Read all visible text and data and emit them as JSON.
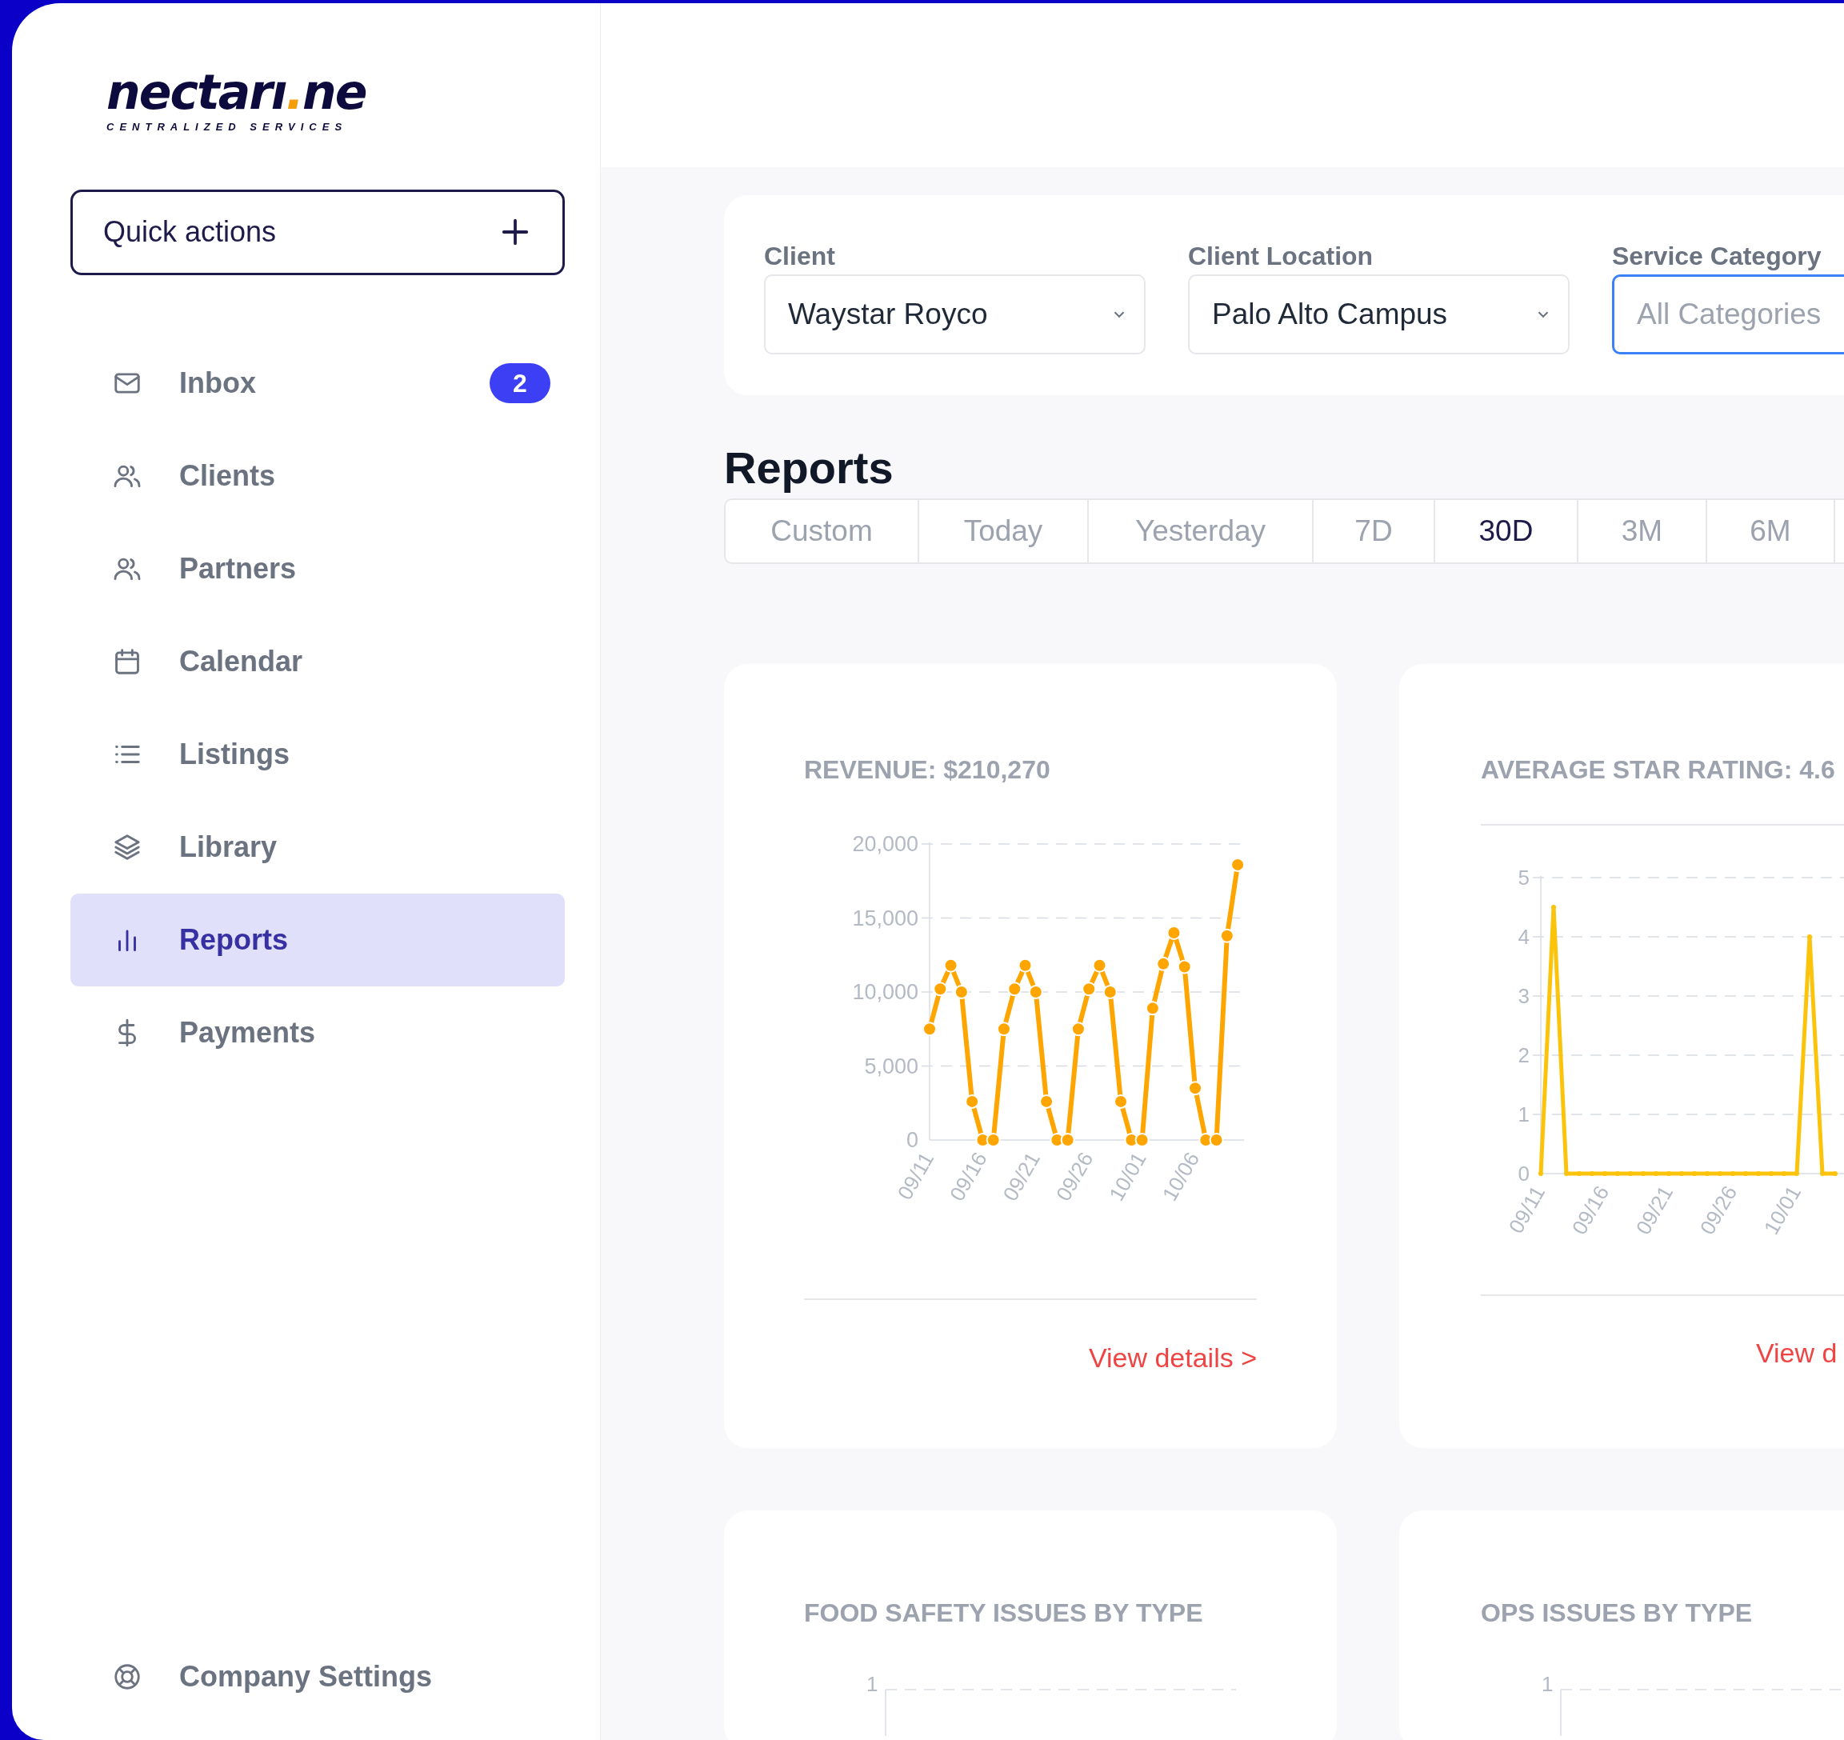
{
  "sidebar": {
    "logo": {
      "wordmark": [
        {
          "text": "nectarı",
          "color": "#0d0b3d"
        },
        {
          "text": ".",
          "color": "#f59e0b"
        },
        {
          "text": "ne",
          "color": "#0d0b3d"
        }
      ],
      "tagline": "CENTRALIZED SERVICES"
    },
    "quick_actions": "Quick actions",
    "nav": [
      {
        "label": "Inbox",
        "selected": false,
        "badge": "2"
      },
      {
        "label": "Clients",
        "selected": false
      },
      {
        "label": "Partners",
        "selected": false
      },
      {
        "label": "Calendar",
        "selected": false
      },
      {
        "label": "Listings",
        "selected": false
      },
      {
        "label": "Library",
        "selected": false
      },
      {
        "label": "Reports",
        "selected": true
      },
      {
        "label": "Payments",
        "selected": false
      }
    ],
    "footer_item": "Company Settings"
  },
  "filters": [
    {
      "label": "Client",
      "value": "Waystar Royco",
      "focused": false
    },
    {
      "label": "Client Location",
      "value": "Palo Alto Campus",
      "focused": false
    },
    {
      "label": "Service Category",
      "placeholder": "All Categories",
      "focused": true
    }
  ],
  "reports": {
    "title": "Reports",
    "ranges": [
      {
        "label": "Custom",
        "selected": false
      },
      {
        "label": "Today",
        "selected": false
      },
      {
        "label": "Yesterday",
        "selected": false
      },
      {
        "label": "7D",
        "selected": false
      },
      {
        "label": "30D",
        "selected": true
      },
      {
        "label": "3M",
        "selected": false
      },
      {
        "label": "6M",
        "selected": false
      }
    ]
  },
  "cards": [
    {
      "kind": "revenue",
      "title": "REVENUE: $210,270",
      "link": "View details >",
      "chart_data": {
        "type": "line",
        "grid": true,
        "categories": [
          "09/11",
          null,
          null,
          null,
          null,
          "09/16",
          null,
          null,
          null,
          null,
          "09/21",
          null,
          null,
          null,
          null,
          "09/26",
          null,
          null,
          null,
          null,
          "10/01",
          null,
          null,
          null,
          null,
          "10/06",
          null,
          null,
          null,
          null
        ],
        "series": [
          {
            "color": "#ffa500",
            "marker": "circle",
            "values": [
              7500,
              10200,
              11800,
              10000,
              2600,
              0,
              0,
              7500,
              10200,
              11800,
              10000,
              2600,
              0,
              0,
              7500,
              10200,
              11800,
              10000,
              2600,
              0,
              0,
              8900,
              11900,
              14000,
              11700,
              3500,
              0,
              0,
              13800,
              18600
            ]
          }
        ],
        "ylim": [
          0,
          20000
        ],
        "yticks": [
          {
            "value": 0,
            "label": "0"
          },
          {
            "value": 5000,
            "label": "5,000"
          },
          {
            "value": 10000,
            "label": "10,000"
          },
          {
            "value": 15000,
            "label": "15,000"
          },
          {
            "value": 20000,
            "label": "20,000"
          }
        ]
      }
    },
    {
      "kind": "rating",
      "title": "AVERAGE STAR RATING: 4.6",
      "link": "View d",
      "chart_data": {
        "type": "line",
        "grid": true,
        "categories": [
          "09/11",
          null,
          null,
          null,
          null,
          "09/16",
          null,
          null,
          null,
          null,
          "09/21",
          null,
          null,
          null,
          null,
          "09/26",
          null,
          null,
          null,
          null,
          "10/01",
          null,
          null,
          null
        ],
        "series": [
          {
            "color": "#fcc30b",
            "marker": "dot",
            "values": [
              0,
              4.5,
              0,
              0,
              0,
              0,
              0,
              0,
              0,
              0,
              0,
              0,
              0,
              0,
              0,
              0,
              0,
              0,
              0,
              0,
              0,
              4,
              0,
              0
            ]
          }
        ],
        "ylim": [
          0,
          5
        ],
        "yticks": [
          0,
          1,
          2,
          3,
          4,
          5
        ]
      }
    },
    {
      "kind": "issues",
      "title": "FOOD SAFETY ISSUES BY TYPE",
      "y_tick": "1"
    },
    {
      "kind": "issues",
      "title": "OPS ISSUES BY TYPE",
      "y_tick": "1"
    }
  ]
}
